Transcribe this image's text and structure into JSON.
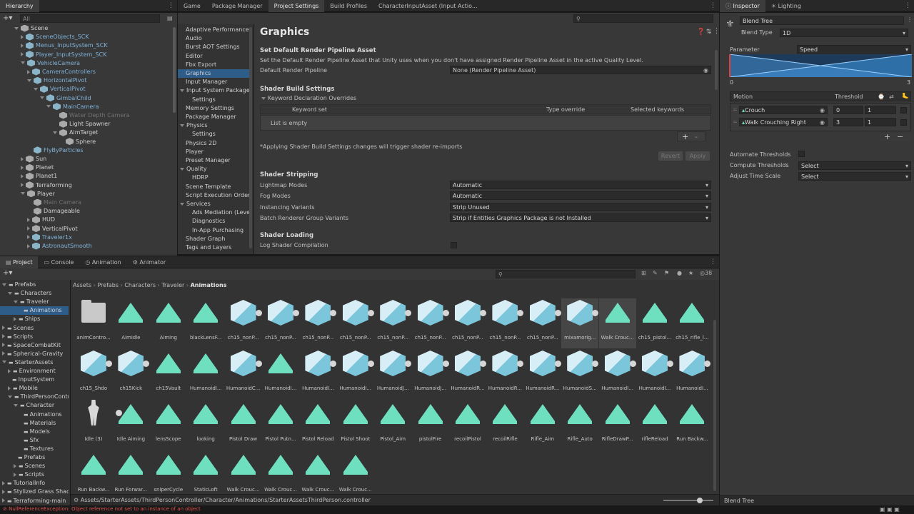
{
  "hierarchy": {
    "tab": "Hierarchy",
    "search_placeholder": "All",
    "items": [
      {
        "label": "Scene",
        "lvl": 0,
        "c": "w",
        "ex": "d"
      },
      {
        "label": "SceneObjects_SCK",
        "lvl": 1,
        "c": "b",
        "ex": "r"
      },
      {
        "label": "Menus_InputSystem_SCK",
        "lvl": 1,
        "c": "b",
        "ex": "r"
      },
      {
        "label": "Player_InputSystem_SCK",
        "lvl": 1,
        "c": "b",
        "ex": "r"
      },
      {
        "label": "VehicleCamera",
        "lvl": 1,
        "c": "b",
        "ex": "d"
      },
      {
        "label": "CameraControllers",
        "lvl": 2,
        "c": "b",
        "ex": "r"
      },
      {
        "label": "HorizontalPivot",
        "lvl": 2,
        "c": "b",
        "ex": "d"
      },
      {
        "label": "VerticalPivot",
        "lvl": 3,
        "c": "b",
        "ex": "d"
      },
      {
        "label": "GimbalChild",
        "lvl": 4,
        "c": "b",
        "ex": "d"
      },
      {
        "label": "MainCamera",
        "lvl": 5,
        "c": "b",
        "ex": "d"
      },
      {
        "label": "Water Depth Camera",
        "lvl": 6,
        "c": "g",
        "ex": ""
      },
      {
        "label": "Light Spawner",
        "lvl": 6,
        "c": "w",
        "ex": ""
      },
      {
        "label": "AimTarget",
        "lvl": 6,
        "c": "w",
        "ex": "d"
      },
      {
        "label": "Sphere",
        "lvl": 7,
        "c": "w",
        "ex": ""
      },
      {
        "label": "FlyByParticles",
        "lvl": 2,
        "c": "b",
        "ex": ""
      },
      {
        "label": "Sun",
        "lvl": 1,
        "c": "w",
        "ex": "r"
      },
      {
        "label": "Planet",
        "lvl": 1,
        "c": "w",
        "ex": "r"
      },
      {
        "label": "Planet1",
        "lvl": 1,
        "c": "w",
        "ex": "r"
      },
      {
        "label": "Terraforming",
        "lvl": 1,
        "c": "w",
        "ex": "r"
      },
      {
        "label": "Player",
        "lvl": 1,
        "c": "w",
        "ex": "d"
      },
      {
        "label": "Main Camera",
        "lvl": 2,
        "c": "g",
        "ex": ""
      },
      {
        "label": "Damageable",
        "lvl": 2,
        "c": "w",
        "ex": ""
      },
      {
        "label": "HUD",
        "lvl": 2,
        "c": "w",
        "ex": "r"
      },
      {
        "label": "VerticalPivot",
        "lvl": 2,
        "c": "w",
        "ex": "r"
      },
      {
        "label": "Traveler1x",
        "lvl": 2,
        "c": "b",
        "ex": "r"
      },
      {
        "label": "AstronautSmooth",
        "lvl": 2,
        "c": "b",
        "ex": "r"
      }
    ]
  },
  "center_tabs": [
    "Game",
    "Package Manager",
    "Project Settings",
    "Build Profiles",
    "CharacterInputAsset (Input Actio..."
  ],
  "settings_nav": [
    {
      "label": "Adaptive Performance",
      "ind": 0,
      "ex": ""
    },
    {
      "label": "Audio",
      "ind": 0,
      "ex": ""
    },
    {
      "label": "Burst AOT Settings",
      "ind": 0,
      "ex": ""
    },
    {
      "label": "Editor",
      "ind": 0,
      "ex": ""
    },
    {
      "label": "Fbx Export",
      "ind": 0,
      "ex": ""
    },
    {
      "label": "Graphics",
      "ind": 0,
      "ex": "",
      "sel": true
    },
    {
      "label": "Input Manager",
      "ind": 0,
      "ex": ""
    },
    {
      "label": "Input System Package",
      "ind": 0,
      "ex": "d"
    },
    {
      "label": "Settings",
      "ind": 1,
      "ex": ""
    },
    {
      "label": "Memory Settings",
      "ind": 0,
      "ex": ""
    },
    {
      "label": "Package Manager",
      "ind": 0,
      "ex": ""
    },
    {
      "label": "Physics",
      "ind": 0,
      "ex": "d"
    },
    {
      "label": "Settings",
      "ind": 1,
      "ex": ""
    },
    {
      "label": "Physics 2D",
      "ind": 0,
      "ex": ""
    },
    {
      "label": "Player",
      "ind": 0,
      "ex": ""
    },
    {
      "label": "Preset Manager",
      "ind": 0,
      "ex": ""
    },
    {
      "label": "Quality",
      "ind": 0,
      "ex": "d"
    },
    {
      "label": "HDRP",
      "ind": 1,
      "ex": ""
    },
    {
      "label": "Scene Template",
      "ind": 0,
      "ex": ""
    },
    {
      "label": "Script Execution Order",
      "ind": 0,
      "ex": ""
    },
    {
      "label": "Services",
      "ind": 0,
      "ex": "d"
    },
    {
      "label": "Ads Mediation (Leve",
      "ind": 1,
      "ex": ""
    },
    {
      "label": "Diagnostics",
      "ind": 1,
      "ex": ""
    },
    {
      "label": "In-App Purchasing",
      "ind": 1,
      "ex": ""
    },
    {
      "label": "Shader Graph",
      "ind": 0,
      "ex": ""
    },
    {
      "label": "Tags and Layers",
      "ind": 0,
      "ex": ""
    }
  ],
  "graphics": {
    "title": "Graphics",
    "rp_header": "Set Default Render Pipeline Asset",
    "rp_desc": "Set the Default Render Pipeline Asset that Unity uses when you don't have assigned Render Pipeline Asset in the active Quality Level.",
    "rp_label": "Default Render Pipeline",
    "rp_value": "None (Render Pipeline Asset)",
    "sbs_header": "Shader Build Settings",
    "kdo_label": "Keyword Declaration Overrides",
    "col_keyword": "Keyword set",
    "col_type": "Type override",
    "col_selected": "Selected keywords",
    "list_empty": "List is empty",
    "plus": "+",
    "minus": "-",
    "note": "*Applying Shader Build Settings changes will trigger shader re-imports",
    "revert": "Revert",
    "apply": "Apply",
    "strip_header": "Shader Stripping",
    "strip_rows": [
      {
        "label": "Lightmap Modes",
        "value": "Automatic"
      },
      {
        "label": "Fog Modes",
        "value": "Automatic"
      },
      {
        "label": "Instancing Variants",
        "value": "Strip Unused"
      },
      {
        "label": "Batch Renderer Group Variants",
        "value": "Strip if Entities Graphics Package is not Installed"
      }
    ],
    "loading_header": "Shader Loading",
    "log_label": "Log Shader Compilation"
  },
  "inspector": {
    "tabs": [
      "Inspector",
      "Lighting"
    ],
    "name": "Blend Tree",
    "blend_type_label": "Blend Type",
    "blend_type": "1D",
    "parameter_label": "Parameter",
    "parameter": "Speed",
    "range_min": "0",
    "range_max": "3",
    "motion_label": "Motion",
    "threshold_label": "Threshold",
    "motions": [
      {
        "name": "Crouch",
        "threshold": "0",
        "speed": "1"
      },
      {
        "name": "Walk Crouching Right",
        "threshold": "3",
        "speed": "1"
      }
    ],
    "automate_label": "Automate Thresholds",
    "compute_label": "Compute Thresholds",
    "compute_value": "Select",
    "adjust_label": "Adjust Time Scale",
    "adjust_value": "Select",
    "footer": "Blend Tree"
  },
  "bottom_tabs": [
    "Project",
    "Console",
    "Animation",
    "Animator"
  ],
  "hidden_count": "38",
  "project_tree": [
    {
      "label": "Prefabs",
      "ind": 0,
      "ex": "d"
    },
    {
      "label": "Characters",
      "ind": 1,
      "ex": "d"
    },
    {
      "label": "Traveler",
      "ind": 2,
      "ex": "d"
    },
    {
      "label": "Animations",
      "ind": 3,
      "ex": "",
      "sel": true
    },
    {
      "label": "Ships",
      "ind": 2,
      "ex": "r"
    },
    {
      "label": "Scenes",
      "ind": 0,
      "ex": "r"
    },
    {
      "label": "Scripts",
      "ind": 0,
      "ex": "r"
    },
    {
      "label": "SpaceCombatKit",
      "ind": 0,
      "ex": "r"
    },
    {
      "label": "Spherical-Gravity",
      "ind": 0,
      "ex": "r"
    },
    {
      "label": "StarterAssets",
      "ind": 0,
      "ex": "d"
    },
    {
      "label": "Environment",
      "ind": 1,
      "ex": "r"
    },
    {
      "label": "InputSystem",
      "ind": 1,
      "ex": ""
    },
    {
      "label": "Mobile",
      "ind": 1,
      "ex": "r"
    },
    {
      "label": "ThirdPersonController",
      "ind": 1,
      "ex": "d"
    },
    {
      "label": "Character",
      "ind": 2,
      "ex": "d"
    },
    {
      "label": "Animations",
      "ind": 3,
      "ex": ""
    },
    {
      "label": "Materials",
      "ind": 3,
      "ex": ""
    },
    {
      "label": "Models",
      "ind": 3,
      "ex": ""
    },
    {
      "label": "Sfx",
      "ind": 3,
      "ex": ""
    },
    {
      "label": "Textures",
      "ind": 3,
      "ex": ""
    },
    {
      "label": "Prefabs",
      "ind": 2,
      "ex": ""
    },
    {
      "label": "Scenes",
      "ind": 2,
      "ex": "r"
    },
    {
      "label": "Scripts",
      "ind": 2,
      "ex": "r"
    },
    {
      "label": "TutorialInfo",
      "ind": 0,
      "ex": "r"
    },
    {
      "label": "Stylized Grass Shader",
      "ind": 0,
      "ex": "r"
    },
    {
      "label": "Terraforming-main",
      "ind": 0,
      "ex": "r"
    }
  ],
  "breadcrumbs": [
    "Assets",
    "Prefabs",
    "Characters",
    "Traveler",
    "Animations"
  ],
  "assets": [
    {
      "n": "animContro...",
      "t": "f"
    },
    {
      "n": "Aimidle",
      "t": "t"
    },
    {
      "n": "Aiming",
      "t": "t"
    },
    {
      "n": "blackLensF...",
      "t": "t"
    },
    {
      "n": "ch15_nonP...",
      "t": "b"
    },
    {
      "n": "ch15_nonP...",
      "t": "b"
    },
    {
      "n": "ch15_nonP...",
      "t": "b"
    },
    {
      "n": "ch15_nonP...",
      "t": "b"
    },
    {
      "n": "ch15_nonP...",
      "t": "b"
    },
    {
      "n": "ch15_nonP...",
      "t": "b"
    },
    {
      "n": "ch15_nonP...",
      "t": "b"
    },
    {
      "n": "ch15_nonP...",
      "t": "b"
    },
    {
      "n": "ch15_nonP...",
      "t": "b"
    },
    {
      "n": "mixamorig...",
      "t": "b"
    },
    {
      "n": "Walk Crouc...",
      "t": "t"
    },
    {
      "n": "ch15_pistol...",
      "t": "t"
    },
    {
      "n": "ch15_rifle_l...",
      "t": "t"
    },
    {
      "n": "ch15_Shdo",
      "t": "b"
    },
    {
      "n": "ch15Kick",
      "t": "b"
    },
    {
      "n": "ch15Vault",
      "t": "t"
    },
    {
      "n": "HumanoidI...",
      "t": "t"
    },
    {
      "n": "HumanoidC...",
      "t": "b"
    },
    {
      "n": "HumanoidI...",
      "t": "t"
    },
    {
      "n": "HumanoidI...",
      "t": "b"
    },
    {
      "n": "HumanoidI...",
      "t": "b"
    },
    {
      "n": "HumanoidJ...",
      "t": "b"
    },
    {
      "n": "HumanoidJ...",
      "t": "b"
    },
    {
      "n": "HumanoidR...",
      "t": "b"
    },
    {
      "n": "HumanoidR...",
      "t": "b"
    },
    {
      "n": "HumanoidR...",
      "t": "b"
    },
    {
      "n": "HumanoidS...",
      "t": "b"
    },
    {
      "n": "HumanoidI...",
      "t": "b"
    },
    {
      "n": "HumanoidI...",
      "t": "b"
    },
    {
      "n": "HumanoidI...",
      "t": "b"
    },
    {
      "n": "Idle (3)",
      "t": "h"
    },
    {
      "n": "Idle Aiming",
      "t": "t"
    },
    {
      "n": "lensScope",
      "t": "t"
    },
    {
      "n": "looking",
      "t": "t"
    },
    {
      "n": "Pistol Draw",
      "t": "t"
    },
    {
      "n": "Pistol Putn...",
      "t": "t"
    },
    {
      "n": "Pistol Reload",
      "t": "t"
    },
    {
      "n": "Pistol Shoot",
      "t": "t"
    },
    {
      "n": "Pistol_Aim",
      "t": "t"
    },
    {
      "n": "pistolFire",
      "t": "t"
    },
    {
      "n": "recoilPistol",
      "t": "t"
    },
    {
      "n": "recoilRifle",
      "t": "t"
    },
    {
      "n": "Rifle_Aim",
      "t": "t"
    },
    {
      "n": "Rifle_Auto",
      "t": "t"
    },
    {
      "n": "RifleDrawP...",
      "t": "t"
    },
    {
      "n": "rifleReload",
      "t": "t"
    },
    {
      "n": "Run Backw...",
      "t": "t"
    },
    {
      "n": "Run Backw...",
      "t": "t"
    },
    {
      "n": "Run Forwar...",
      "t": "t"
    },
    {
      "n": "sniperCycle",
      "t": "t"
    },
    {
      "n": "StaticLoft",
      "t": "t"
    },
    {
      "n": "Walk Crouc...",
      "t": "t"
    },
    {
      "n": "Walk Crouc...",
      "t": "t"
    },
    {
      "n": "Walk Crouc...",
      "t": "t"
    },
    {
      "n": "Walk Crouc...",
      "t": "t"
    }
  ],
  "footer_path": "Assets/StarterAssets/ThirdPersonController/Character/Animations/StarterAssetsThirdPerson.controller",
  "status_error": "NullReferenceException: Object reference not set to an instance of an object"
}
